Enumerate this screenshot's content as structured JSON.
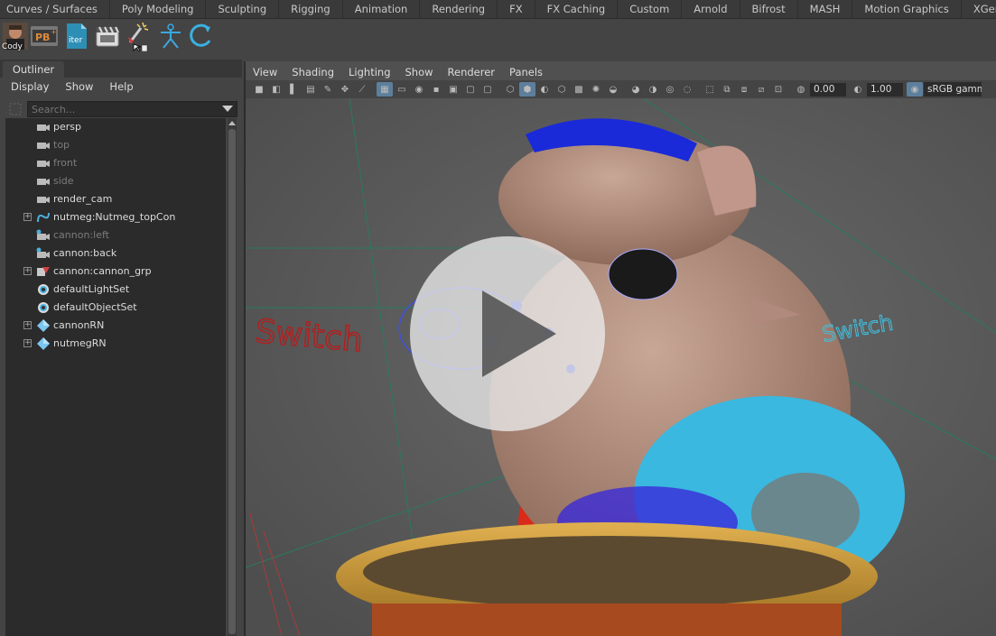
{
  "shelf_tabs": [
    "Curves / Surfaces",
    "Poly Modeling",
    "Sculpting",
    "Rigging",
    "Animation",
    "Rendering",
    "FX",
    "FX Caching",
    "Custom",
    "Arnold",
    "Bifrost",
    "MASH",
    "Motion Graphics",
    "XGen"
  ],
  "shelf": {
    "avatar_label": "Cody",
    "pb_label": "PB",
    "iter_label": "iter",
    "icons": [
      "cody-avatar-icon",
      "playblast-icon",
      "iter-icon",
      "clapper-icon",
      "magic-wand-icon",
      "joint-icon",
      "refresh-icon"
    ]
  },
  "outliner": {
    "tab_label": "Outliner",
    "menu": [
      "Display",
      "Show",
      "Help"
    ],
    "search_placeholder": "Search...",
    "items": [
      {
        "label": "persp",
        "icon": "camera-icon",
        "dim": false,
        "expand": false
      },
      {
        "label": "top",
        "icon": "camera-icon",
        "dim": true,
        "expand": false
      },
      {
        "label": "front",
        "icon": "camera-icon",
        "dim": true,
        "expand": false
      },
      {
        "label": "side",
        "icon": "camera-icon",
        "dim": true,
        "expand": false
      },
      {
        "label": "render_cam",
        "icon": "camera-icon",
        "dim": false,
        "expand": false
      },
      {
        "label": "nutmeg:Nutmeg_topCon",
        "icon": "curve-icon",
        "dim": false,
        "expand": true
      },
      {
        "label": "cannon:left",
        "icon": "camera-blue-icon",
        "dim": true,
        "expand": false
      },
      {
        "label": "cannon:back",
        "icon": "camera-blue-icon",
        "dim": false,
        "expand": false
      },
      {
        "label": "cannon:cannon_grp",
        "icon": "group-icon",
        "dim": false,
        "expand": true
      },
      {
        "label": "defaultLightSet",
        "icon": "set-icon",
        "dim": false,
        "expand": false
      },
      {
        "label": "defaultObjectSet",
        "icon": "set-icon",
        "dim": false,
        "expand": false
      },
      {
        "label": "cannonRN",
        "icon": "reference-icon",
        "dim": false,
        "expand": true
      },
      {
        "label": "nutmegRN",
        "icon": "reference-icon",
        "dim": false,
        "expand": true
      }
    ]
  },
  "viewport": {
    "menu": [
      "View",
      "Shading",
      "Lighting",
      "Show",
      "Renderer",
      "Panels"
    ],
    "exposure": "0.00",
    "gamma": "1.00",
    "color_space": "sRGB gamm",
    "scene_labels": {
      "left": "Switch",
      "right": "Switch"
    }
  },
  "colors": {
    "accent": "#5d7f9c",
    "play_button": "#e6e6e6"
  }
}
